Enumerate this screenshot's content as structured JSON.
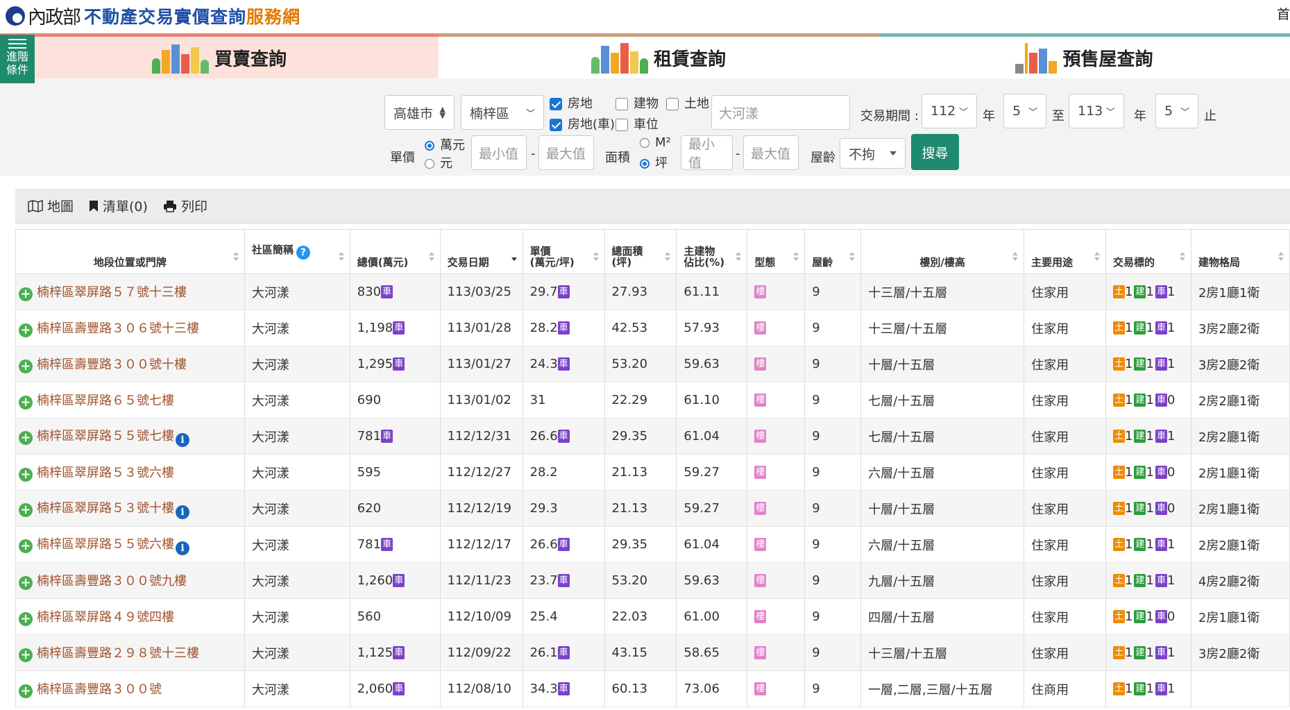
{
  "header": {
    "ministry": "內政部",
    "title": "不動產交易實價查詢",
    "title_accent": "服務網",
    "right_text": "首"
  },
  "advanced_button": {
    "line1": "進階",
    "line2": "條件"
  },
  "tabs": [
    {
      "label": "買賣查詢"
    },
    {
      "label": "租賃查詢"
    },
    {
      "label": "預售屋查詢"
    }
  ],
  "filter": {
    "city": "高雄市",
    "district": "楠梓區",
    "checkboxes": [
      {
        "label": "房地",
        "checked": true
      },
      {
        "label": "建物",
        "checked": false
      },
      {
        "label": "土地",
        "checked": false
      },
      {
        "label": "房地(車)",
        "checked": true
      },
      {
        "label": "車位",
        "checked": false
      }
    ],
    "keyword_placeholder": "大河漾",
    "period_label": "交易期間 :",
    "start_year": "112",
    "start_month": "5",
    "year_text": "年",
    "to_text": "至",
    "end_year": "113",
    "end_month": "5",
    "end_text": "止",
    "unit_price_label": "單價",
    "unit_options": [
      {
        "label": "萬元",
        "selected": true
      },
      {
        "label": "元",
        "selected": false
      }
    ],
    "min_placeholder": "最小值",
    "max_placeholder": "最大值",
    "dash": "-",
    "area_label": "面積",
    "area_options": [
      {
        "label": "M²",
        "selected": false
      },
      {
        "label": "坪",
        "selected": true
      }
    ],
    "age_label": "屋齡",
    "age_value": "不拘",
    "search_label": "搜尋"
  },
  "toolbar": {
    "map_label": "地圖",
    "list_label": "清單(0)",
    "print_label": "列印"
  },
  "columns": [
    "地段位置或門牌",
    "社區簡稱",
    "總價(萬元)",
    "交易日期",
    "單價\n(萬元/坪)",
    "總面積\n(坪)",
    "主建物\n佔比(%)",
    "型態",
    "屋齡",
    "樓別/樓高",
    "主要用途",
    "交易標的",
    "建物格局"
  ],
  "badges": {
    "car": "車",
    "building_type": "樓",
    "land": "土",
    "build": "建"
  },
  "rows": [
    {
      "address": "楠梓區翠屏路５７號十三樓",
      "info": false,
      "community": "大河漾",
      "total": "830",
      "total_car": true,
      "date": "113/03/25",
      "unit": "29.7",
      "unit_car": true,
      "area": "27.93",
      "ratio": "61.11",
      "age": "9",
      "floor": "十三層/十五層",
      "use": "住家用",
      "t_land": "1",
      "t_build": "1",
      "t_car": "1",
      "layout": "2房1廳1衛"
    },
    {
      "address": "楠梓區壽豐路３０６號十三樓",
      "info": false,
      "community": "大河漾",
      "total": "1,198",
      "total_car": true,
      "date": "113/01/28",
      "unit": "28.2",
      "unit_car": true,
      "area": "42.53",
      "ratio": "57.93",
      "age": "9",
      "floor": "十三層/十五層",
      "use": "住家用",
      "t_land": "1",
      "t_build": "1",
      "t_car": "1",
      "layout": "3房2廳2衛"
    },
    {
      "address": "楠梓區壽豐路３００號十樓",
      "info": false,
      "community": "大河漾",
      "total": "1,295",
      "total_car": true,
      "date": "113/01/27",
      "unit": "24.3",
      "unit_car": true,
      "area": "53.20",
      "ratio": "59.63",
      "age": "9",
      "floor": "十層/十五層",
      "use": "住家用",
      "t_land": "1",
      "t_build": "1",
      "t_car": "1",
      "layout": "3房2廳2衛"
    },
    {
      "address": "楠梓區翠屏路６５號七樓",
      "info": false,
      "community": "大河漾",
      "total": "690",
      "total_car": false,
      "date": "113/01/02",
      "unit": "31",
      "unit_car": false,
      "area": "22.29",
      "ratio": "61.10",
      "age": "9",
      "floor": "七層/十五層",
      "use": "住家用",
      "t_land": "1",
      "t_build": "1",
      "t_car": "0",
      "layout": "2房2廳1衛"
    },
    {
      "address": "楠梓區翠屏路５５號七樓",
      "info": true,
      "community": "大河漾",
      "total": "781",
      "total_car": true,
      "date": "112/12/31",
      "unit": "26.6",
      "unit_car": true,
      "area": "29.35",
      "ratio": "61.04",
      "age": "9",
      "floor": "七層/十五層",
      "use": "住家用",
      "t_land": "1",
      "t_build": "1",
      "t_car": "1",
      "layout": "2房2廳1衛"
    },
    {
      "address": "楠梓區翠屏路５３號六樓",
      "info": false,
      "community": "大河漾",
      "total": "595",
      "total_car": false,
      "date": "112/12/27",
      "unit": "28.2",
      "unit_car": false,
      "area": "21.13",
      "ratio": "59.27",
      "age": "9",
      "floor": "六層/十五層",
      "use": "住家用",
      "t_land": "1",
      "t_build": "1",
      "t_car": "0",
      "layout": "2房1廳1衛"
    },
    {
      "address": "楠梓區翠屏路５３號十樓",
      "info": true,
      "community": "大河漾",
      "total": "620",
      "total_car": false,
      "date": "112/12/19",
      "unit": "29.3",
      "unit_car": false,
      "area": "21.13",
      "ratio": "59.27",
      "age": "9",
      "floor": "十層/十五層",
      "use": "住家用",
      "t_land": "1",
      "t_build": "1",
      "t_car": "0",
      "layout": "2房1廳1衛"
    },
    {
      "address": "楠梓區翠屏路５５號六樓",
      "info": true,
      "community": "大河漾",
      "total": "781",
      "total_car": true,
      "date": "112/12/17",
      "unit": "26.6",
      "unit_car": true,
      "area": "29.35",
      "ratio": "61.04",
      "age": "9",
      "floor": "六層/十五層",
      "use": "住家用",
      "t_land": "1",
      "t_build": "1",
      "t_car": "1",
      "layout": "2房2廳1衛"
    },
    {
      "address": "楠梓區壽豐路３００號九樓",
      "info": false,
      "community": "大河漾",
      "total": "1,260",
      "total_car": true,
      "date": "112/11/23",
      "unit": "23.7",
      "unit_car": true,
      "area": "53.20",
      "ratio": "59.63",
      "age": "9",
      "floor": "九層/十五層",
      "use": "住家用",
      "t_land": "1",
      "t_build": "1",
      "t_car": "1",
      "layout": "4房2廳2衛"
    },
    {
      "address": "楠梓區翠屏路４９號四樓",
      "info": false,
      "community": "大河漾",
      "total": "560",
      "total_car": false,
      "date": "112/10/09",
      "unit": "25.4",
      "unit_car": false,
      "area": "22.03",
      "ratio": "61.00",
      "age": "9",
      "floor": "四層/十五層",
      "use": "住家用",
      "t_land": "1",
      "t_build": "1",
      "t_car": "0",
      "layout": "2房1廳1衛"
    },
    {
      "address": "楠梓區壽豐路２９８號十三樓",
      "info": false,
      "community": "大河漾",
      "total": "1,125",
      "total_car": true,
      "date": "112/09/22",
      "unit": "26.1",
      "unit_car": true,
      "area": "43.15",
      "ratio": "58.65",
      "age": "9",
      "floor": "十三層/十五層",
      "use": "住家用",
      "t_land": "1",
      "t_build": "1",
      "t_car": "1",
      "layout": "3房2廳2衛"
    },
    {
      "address": "楠梓區壽豐路３００號",
      "info": false,
      "community": "大河漾",
      "total": "2,060",
      "total_car": true,
      "date": "112/08/10",
      "unit": "34.3",
      "unit_car": true,
      "area": "60.13",
      "ratio": "73.06",
      "age": "9",
      "floor": "一層,二層,三層/十五層",
      "use": "住商用",
      "t_land": "1",
      "t_build": "1",
      "t_car": "1",
      "layout": ""
    }
  ],
  "colors": {
    "brand_green": "#1e8a6e",
    "address_brown": "#a0522d",
    "title_blue": "#1f4fa6",
    "title_orange": "#e07b00",
    "car_badge": "#7b42c8",
    "type_badge": "#e083c9",
    "land_badge": "#f08a00",
    "build_badge": "#2e9d3e"
  }
}
